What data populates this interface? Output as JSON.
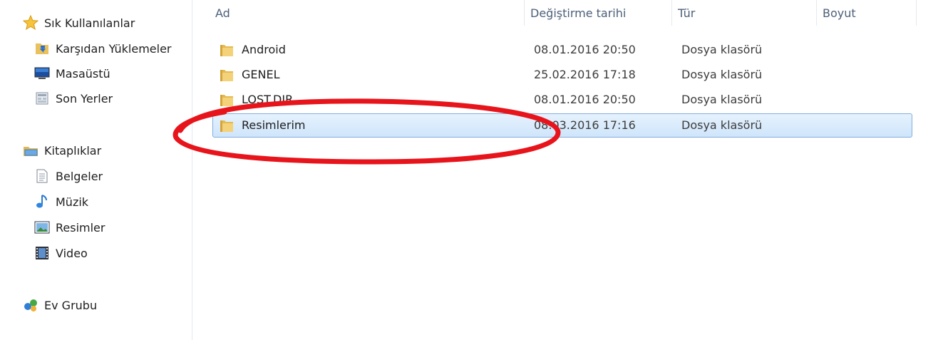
{
  "nav": {
    "favorites": {
      "label": "Sık Kullanılanlar",
      "items": [
        "Karşıdan Yüklemeler",
        "Masaüstü",
        "Son Yerler"
      ]
    },
    "libraries": {
      "label": "Kitaplıklar",
      "items": [
        "Belgeler",
        "Müzik",
        "Resimler",
        "Video"
      ]
    },
    "homegroup": {
      "label": "Ev Grubu"
    }
  },
  "columns": {
    "name": "Ad",
    "date": "Değiştirme tarihi",
    "type": "Tür",
    "size": "Boyut"
  },
  "files": [
    {
      "name": "Android",
      "date": "08.01.2016 20:50",
      "type": "Dosya klasörü"
    },
    {
      "name": "GENEL",
      "date": "25.02.2016 17:18",
      "type": "Dosya klasörü"
    },
    {
      "name": "LOST.DIR",
      "date": "08.01.2016 20:50",
      "type": "Dosya klasörü"
    },
    {
      "name": "Resimlerim",
      "date": "08.03.2016 17:16",
      "type": "Dosya klasörü",
      "selected": true
    }
  ],
  "colors": {
    "selection_bg": "#cfe5fb",
    "selection_border": "#84acdd",
    "annotation": "#e8141b"
  }
}
